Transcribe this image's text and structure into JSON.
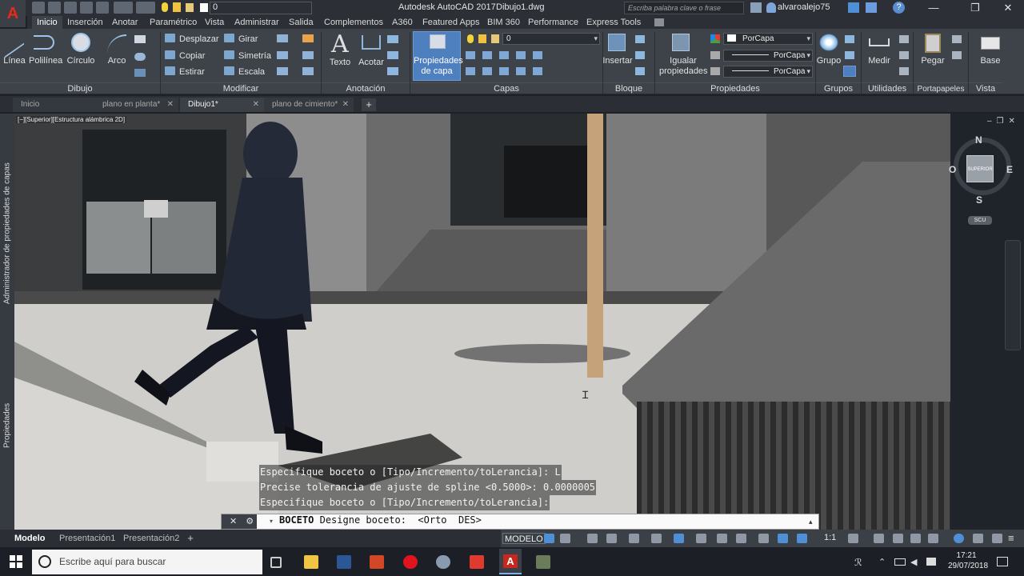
{
  "app": {
    "title": "Autodesk AutoCAD 2017",
    "document": "Dibujo1.dwg",
    "brand": "A",
    "layer_value": "0",
    "search_placeholder": "Escriba palabra clave o frase",
    "user": "alvaroalejo75"
  },
  "ribbon_tabs": [
    "Inicio",
    "Inserción",
    "Anotar",
    "Paramétrico",
    "Vista",
    "Administrar",
    "Salida",
    "Complementos",
    "A360",
    "Featured Apps",
    "BIM 360",
    "Performance",
    "Express Tools"
  ],
  "dibujo": {
    "linea": "Línea",
    "polilinea": "Polilínea",
    "circulo": "Círculo",
    "arco": "Arco",
    "title": "Dibujo"
  },
  "modificar": {
    "desplazar": "Desplazar",
    "girar": "Girar",
    "copiar": "Copiar",
    "simetria": "Simetría",
    "estirar": "Estirar",
    "escala": "Escala",
    "title": "Modificar"
  },
  "anotacion": {
    "texto": "Texto",
    "acotar": "Acotar",
    "title": "Anotación"
  },
  "capas": {
    "propiedades": "Propiedades de capa",
    "layer": "0",
    "title": "Capas"
  },
  "bloque": {
    "insertar": "Insertar",
    "title": "Bloque"
  },
  "propiedades": {
    "igualar": "Igualar propiedades",
    "color": "PorCapa",
    "tipo": "PorCapa",
    "grosor": "PorCapa",
    "title": "Propiedades"
  },
  "grupos": {
    "grupo": "Grupo",
    "title": "Grupos"
  },
  "utilidades": {
    "medir": "Medir",
    "title": "Utilidades"
  },
  "portapapeles": {
    "pegar": "Pegar",
    "title": "Portapapeles"
  },
  "vista": {
    "base": "Base",
    "title": "Vista"
  },
  "doc_tabs": [
    "Inicio",
    "plano en planta*",
    "Dibujo1*",
    "plano de cimiento*"
  ],
  "viewport_label": "[−][Superior][Estructura alámbrica 2D]",
  "left_palettes": [
    "Administrador de propiedades de capas",
    "Propiedades"
  ],
  "viewcube": {
    "n": "N",
    "s": "S",
    "e": "E",
    "o": "O",
    "face": "SUPERIOR",
    "ucs": "SCU"
  },
  "cmd_history": [
    "Especifique boceto o [Tipo/Incremento/toLerancia]: L",
    "Precise tolerancia de ajuste de spline <0.5000>: 0.0000005",
    "Especifique boceto o [Tipo/Incremento/toLerancia]:"
  ],
  "cmd_current": {
    "name": "BOCETO",
    "prompt": "Designe boceto:  <Orto  DES>"
  },
  "layout_tabs": [
    "Modelo",
    "Presentación1",
    "Presentación2"
  ],
  "status": {
    "model": "MODELO",
    "scale": "1:1"
  },
  "taskbar": {
    "search": "Escribe aquí para buscar",
    "time": "17:21",
    "date": "29/07/2018"
  },
  "colors": {
    "accent": "#4e7fbf",
    "brand": "#e8281e",
    "ribbon": "#3e434a"
  }
}
